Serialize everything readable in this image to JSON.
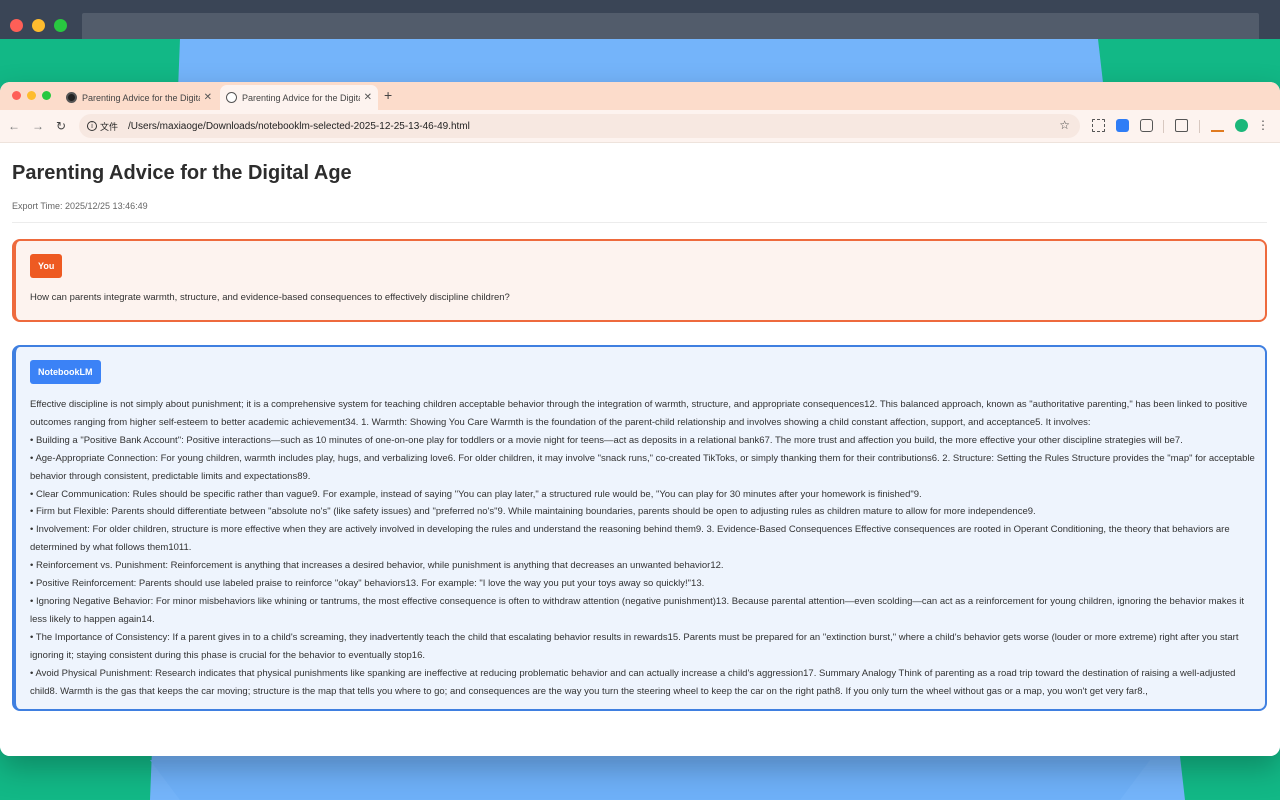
{
  "browser": {
    "tabs": [
      {
        "title": "Parenting Advice for the Digital Age",
        "active": false
      },
      {
        "title": "Parenting Advice for the Digital Age",
        "active": true
      }
    ],
    "new_tab": "+",
    "address_chip": "文件",
    "url": "/Users/maxiaoge/Downloads/notebooklm-selected-2025-12-25-13-46-49.html"
  },
  "page": {
    "title": "Parenting Advice for the Digital Age",
    "export_time": "Export Time: 2025/12/25 13:46:49"
  },
  "you": {
    "badge": "You",
    "question": "How can parents integrate warmth, structure, and evidence-based consequences to effectively discipline children?"
  },
  "notebook": {
    "badge": "NotebookLM",
    "paragraphs": [
      "Effective discipline is not simply about punishment; it is a comprehensive system for teaching children acceptable behavior through the integration of warmth, structure, and appropriate consequences12. This balanced approach, known as \"authoritative parenting,\" has been linked to positive outcomes ranging from higher self-esteem to better academic achievement34. 1. Warmth: Showing You Care Warmth is the foundation of the parent-child relationship and involves showing a child constant affection, support, and acceptance5. It involves:",
      "• Building a \"Positive Bank Account\": Positive interactions—such as 10 minutes of one-on-one play for toddlers or a movie night for teens—act as deposits in a relational bank67. The more trust and affection you build, the more effective your other discipline strategies will be7.",
      "• Age-Appropriate Connection: For young children, warmth includes play, hugs, and verbalizing love6. For older children, it may involve \"snack runs,\" co-created TikToks, or simply thanking them for their contributions6. 2. Structure: Setting the Rules Structure provides the \"map\" for acceptable behavior through consistent, predictable limits and expectations89.",
      "• Clear Communication: Rules should be specific rather than vague9. For example, instead of saying \"You can play later,\" a structured rule would be, \"You can play for 30 minutes after your homework is finished\"9.",
      "• Firm but Flexible: Parents should differentiate between \"absolute no's\" (like safety issues) and \"preferred no's\"9. While maintaining boundaries, parents should be open to adjusting rules as children mature to allow for more independence9.",
      "• Involvement: For older children, structure is more effective when they are actively involved in developing the rules and understand the reasoning behind them9. 3. Evidence-Based Consequences Effective consequences are rooted in Operant Conditioning, the theory that behaviors are determined by what follows them1011.",
      "• Reinforcement vs. Punishment: Reinforcement is anything that increases a desired behavior, while punishment is anything that decreases an unwanted behavior12.",
      "• Positive Reinforcement: Parents should use labeled praise to reinforce \"okay\" behaviors13. For example: \"I love the way you put your toys away so quickly!\"13.",
      "• Ignoring Negative Behavior: For minor misbehaviors like whining or tantrums, the most effective consequence is often to withdraw attention (negative punishment)13. Because parental attention—even scolding—can act as a reinforcement for young children, ignoring the behavior makes it less likely to happen again14.",
      "• The Importance of Consistency: If a parent gives in to a child's screaming, they inadvertently teach the child that escalating behavior results in rewards15. Parents must be prepared for an \"extinction burst,\" where a child's behavior gets worse (louder or more extreme) right after you start ignoring it; staying consistent during this phase is crucial for the behavior to eventually stop16.",
      "• Avoid Physical Punishment: Research indicates that physical punishments like spanking are ineffective at reducing problematic behavior and can actually increase a child's aggression17. Summary Analogy Think of parenting as a road trip toward the destination of raising a well-adjusted child8. Warmth is the gas that keeps the car moving; structure is the map that tells you where to go; and consequences are the way you turn the steering wheel to keep the car on the right path8. If you only turn the wheel without gas or a map, you won't get very far8.,"
    ]
  },
  "colors": {
    "you_accent": "#ee5a22",
    "notebook_accent": "#3b82f6",
    "tab_strip": "#fcdccb"
  }
}
